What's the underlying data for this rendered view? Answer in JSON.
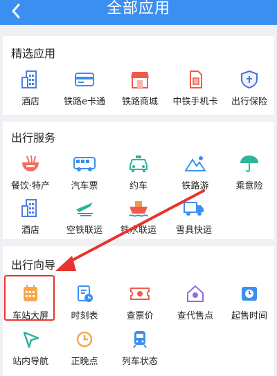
{
  "header": {
    "title": "全部应用",
    "back_icon": "chevron-left-icon",
    "bg": "#3b8ff0"
  },
  "sections": [
    {
      "title": "精选应用",
      "items": [
        {
          "label": "酒店",
          "icon": "building-icon"
        },
        {
          "label": "铁路e卡通",
          "icon": "card-icon"
        },
        {
          "label": "铁路商城",
          "icon": "shop-icon"
        },
        {
          "label": "中铁手机卡",
          "icon": "sim-card-icon"
        },
        {
          "label": "出行保险",
          "icon": "insurance-shield-icon"
        }
      ]
    },
    {
      "title": "出行服务",
      "items": [
        {
          "label": "餐饮·特产",
          "icon": "noodle-bowl-icon"
        },
        {
          "label": "汽车票",
          "icon": "bus-icon"
        },
        {
          "label": "约车",
          "icon": "taxi-icon"
        },
        {
          "label": "铁路游",
          "icon": "mountain-icon"
        },
        {
          "label": "乘意险",
          "icon": "umbrella-icon"
        },
        {
          "label": "酒店",
          "icon": "building-icon"
        },
        {
          "label": "空铁联运",
          "icon": "plane-icon"
        },
        {
          "label": "铁水联运",
          "icon": "ship-icon"
        },
        {
          "label": "雪具快运",
          "icon": "truck-icon"
        }
      ]
    },
    {
      "title": "出行向导",
      "items": [
        {
          "label": "车站大屏",
          "icon": "calendar-screen-icon"
        },
        {
          "label": "时刻表",
          "icon": "timetable-icon"
        },
        {
          "label": "查票价",
          "icon": "ticket-price-icon"
        },
        {
          "label": "查代售点",
          "icon": "home-location-icon"
        },
        {
          "label": "起售时间",
          "icon": "alarm-clock-icon"
        },
        {
          "label": "站内导航",
          "icon": "navigation-arrow-icon"
        },
        {
          "label": "正晚点",
          "icon": "clock-icon"
        },
        {
          "label": "列车状态",
          "icon": "train-icon"
        }
      ]
    }
  ],
  "annotation": {
    "color": "#e8332e",
    "highlight_item": "车站大屏"
  }
}
